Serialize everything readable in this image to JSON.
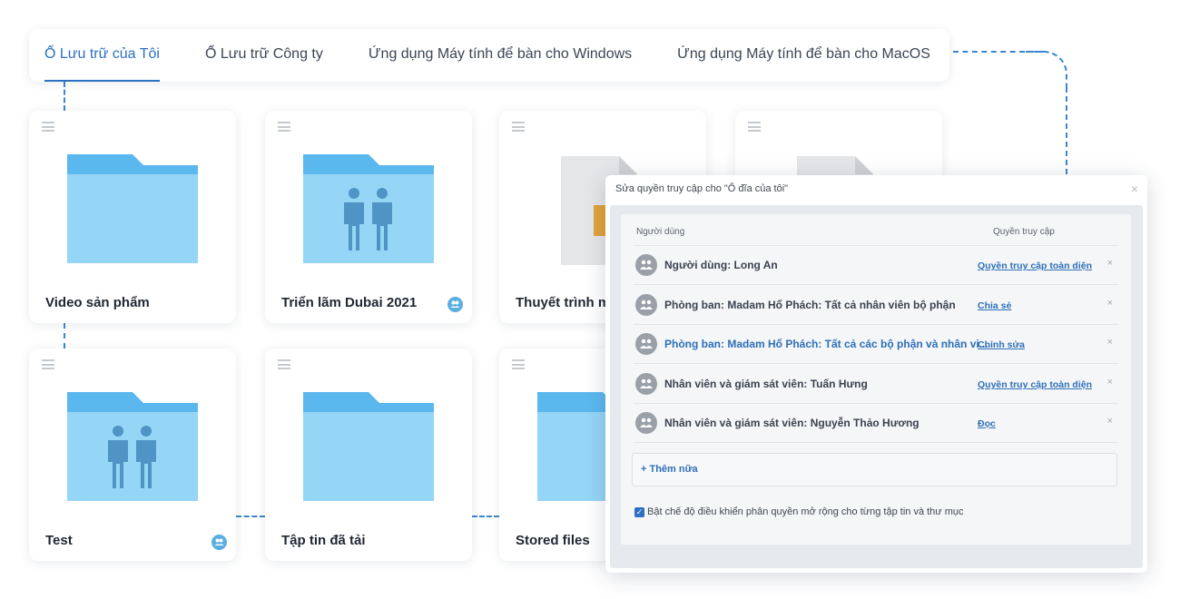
{
  "tabs": [
    {
      "label": "Ổ Lưu trữ của Tôi",
      "active": true
    },
    {
      "label": "Ổ Lưu trữ Công ty",
      "active": false
    },
    {
      "label": "Ứng dụng Máy tính để bàn cho Windows",
      "active": false
    },
    {
      "label": "Ứng dụng Máy tính để bàn cho MacOS",
      "active": false
    }
  ],
  "cards": [
    {
      "title": "Video sản phẩm",
      "type": "folder",
      "shared": false
    },
    {
      "title": "Triển lãm Dubai 2021",
      "type": "folder-people",
      "shared": true
    },
    {
      "title": "Thuyết trình m",
      "type": "file",
      "shared": false
    },
    {
      "title": "",
      "type": "file",
      "shared": false
    },
    {
      "title": "Test",
      "type": "folder-people",
      "shared": true
    },
    {
      "title": "Tập tin đã tải",
      "type": "folder",
      "shared": false
    },
    {
      "title": "Stored files",
      "type": "folder",
      "shared": false
    }
  ],
  "modal": {
    "title": "Sửa quyền truy cập cho \"Ổ đĩa của tôi\"",
    "close": "×",
    "col_user": "Người dùng",
    "col_access": "Quyền truy cập",
    "rows": [
      {
        "name": "Người dùng: Long An",
        "permission": "Quyền truy cập toàn diện",
        "highlight": false
      },
      {
        "name": "Phòng ban: Madam Hổ Phách: Tất cả nhân viên bộ phận",
        "permission": "Chia sẻ",
        "highlight": false
      },
      {
        "name": "Phòng ban: Madam Hổ Phách: Tất cả các bộ phận và nhân vi...",
        "permission": "Chỉnh sửa",
        "highlight": true
      },
      {
        "name": "Nhân viên và giám sát viên: Tuấn Hưng",
        "permission": "Quyền truy cập toàn diện",
        "highlight": false
      },
      {
        "name": "Nhân viên và giám sát viên: Nguyễn Thảo Hương",
        "permission": "Đọc",
        "highlight": false
      }
    ],
    "remove": "×",
    "add_more": "+ Thêm nữa",
    "extended_checkbox": {
      "checked": true,
      "label": "Bật chế độ điều khiển phân quyền mở rộng cho từng tập tin và thư mục"
    }
  },
  "colors": {
    "accent": "#2c6fc2",
    "folder_tab": "#5bb8ee",
    "folder_body": "#95d5f6",
    "person": "#4f94c4",
    "connector": "#3b86cf"
  }
}
